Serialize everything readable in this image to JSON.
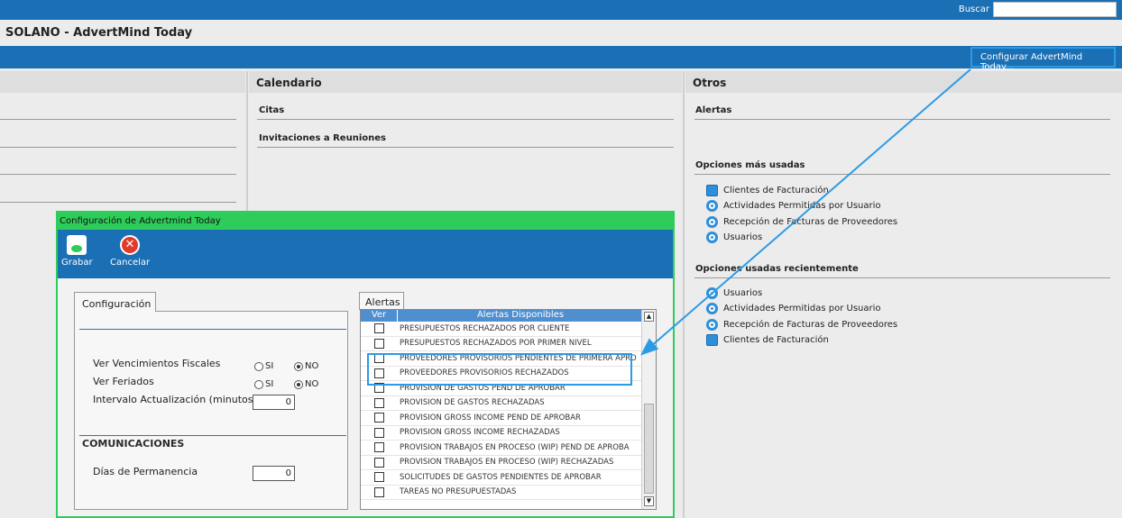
{
  "topbar": {
    "search_label": "Buscar",
    "search_value": ""
  },
  "app": {
    "title": "SOLANO - AdvertMind Today",
    "config_link": "Configurar AdvertMind Today..."
  },
  "calendar": {
    "header": "Calendario",
    "citas": "Citas",
    "invitaciones": "Invitaciones a Reuniones"
  },
  "otros": {
    "header": "Otros",
    "alertas": "Alertas",
    "mas_usadas_title": "Opciones más usadas",
    "mas_usadas": [
      {
        "label": "Clientes de Facturación",
        "icon": "list-icon"
      },
      {
        "label": "Actividades Permitidas por Usuario",
        "icon": "gear-icon"
      },
      {
        "label": "Recepción de Facturas de Proveedores",
        "icon": "gear-icon"
      },
      {
        "label": "Usuarios",
        "icon": "gear-icon"
      }
    ],
    "recientes_title": "Opciones usadas recientemente",
    "recientes": [
      {
        "label": "Usuarios",
        "icon": "gear-icon"
      },
      {
        "label": "Actividades Permitidas por Usuario",
        "icon": "gear-icon"
      },
      {
        "label": "Recepción de Facturas de Proveedores",
        "icon": "gear-icon"
      },
      {
        "label": "Clientes de Facturación",
        "icon": "list-icon"
      }
    ]
  },
  "modal": {
    "title": "Configuración de Advertmind Today",
    "save": "Grabar",
    "cancel": "Cancelar",
    "tab_config": "Configuración",
    "tab_alertas": "Alertas",
    "fields": {
      "venc_label": "Ver Vencimientos Fiscales",
      "feriados_label": "Ver Feriados",
      "intervalo_label": "Intervalo Actualización (minutos)",
      "intervalo_value": "0",
      "si": "SI",
      "no": "NO",
      "comunicaciones": "COMUNICACIONES",
      "dias_label": "Días de Permanencia",
      "dias_value": "0"
    },
    "alerts": {
      "col_ver": "Ver",
      "col_alertas": "Alertas Disponibles",
      "rows": [
        "PRESUPUESTOS RECHAZADOS POR CLIENTE",
        "PRESUPUESTOS RECHAZADOS POR PRIMER NIVEL",
        "PROVEEDORES PROVISORIOS PENDIENTES DE PRIMERA APRO",
        "PROVEEDORES PROVISORIOS RECHAZADOS",
        "PROVISIÓN DE GASTOS PEND DE APROBAR",
        "PROVISIÓN DE GASTOS RECHAZADAS",
        "PROVISIÓN GROSS INCOME PEND DE APROBAR",
        "PROVISIÓN GROSS INCOME RECHAZADAS",
        "PROVISIÓN TRABAJOS EN PROCESO (WIP) PEND DE APROBA",
        "PROVISIÓN TRABAJOS EN PROCESO (WIP) RECHAZADAS",
        "SOLICITUDES DE GASTOS PENDIENTES DE APROBAR",
        "TAREAS NO PRESUPUESTADAS"
      ]
    }
  }
}
